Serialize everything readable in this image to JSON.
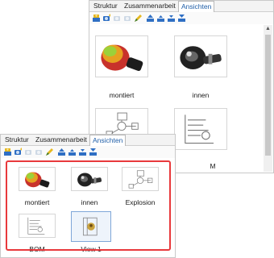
{
  "tabs": [
    "Struktur",
    "Zusammenarbeit",
    "Ansichten"
  ],
  "active_tab": "Ansichten",
  "toolbar_icons": [
    "add-view-icon",
    "camera-view-icon",
    "camera-disabled-icon",
    "camera-disabled-2-icon",
    "edit-view-icon",
    "move-first-icon",
    "move-up-icon",
    "move-down-icon",
    "move-last-icon"
  ],
  "back_panel": {
    "views": [
      {
        "label": "montiert",
        "image": "assembled-device-icon"
      },
      {
        "label": "innen",
        "image": "interior-device-icon"
      },
      {
        "label": "",
        "image": "explosion-drawing-icon"
      },
      {
        "label": "M",
        "image": "bom-drawing-icon"
      }
    ]
  },
  "front_panel": {
    "views": [
      {
        "label": "montiert",
        "image": "assembled-device-icon"
      },
      {
        "label": "innen",
        "image": "interior-device-icon"
      },
      {
        "label": "Explosion",
        "image": "explosion-drawing-icon"
      },
      {
        "label": "BOM",
        "image": "bom-drawing-icon"
      },
      {
        "label": "View 1",
        "image": "view1-sketch-icon"
      }
    ],
    "selected_view": "View 1"
  },
  "colors": {
    "highlight_border": "#e8393c",
    "active_tab_text": "#1f5ea8",
    "toolbar_blue": "#2f6fc4",
    "toolbar_yellow": "#e6b820"
  }
}
